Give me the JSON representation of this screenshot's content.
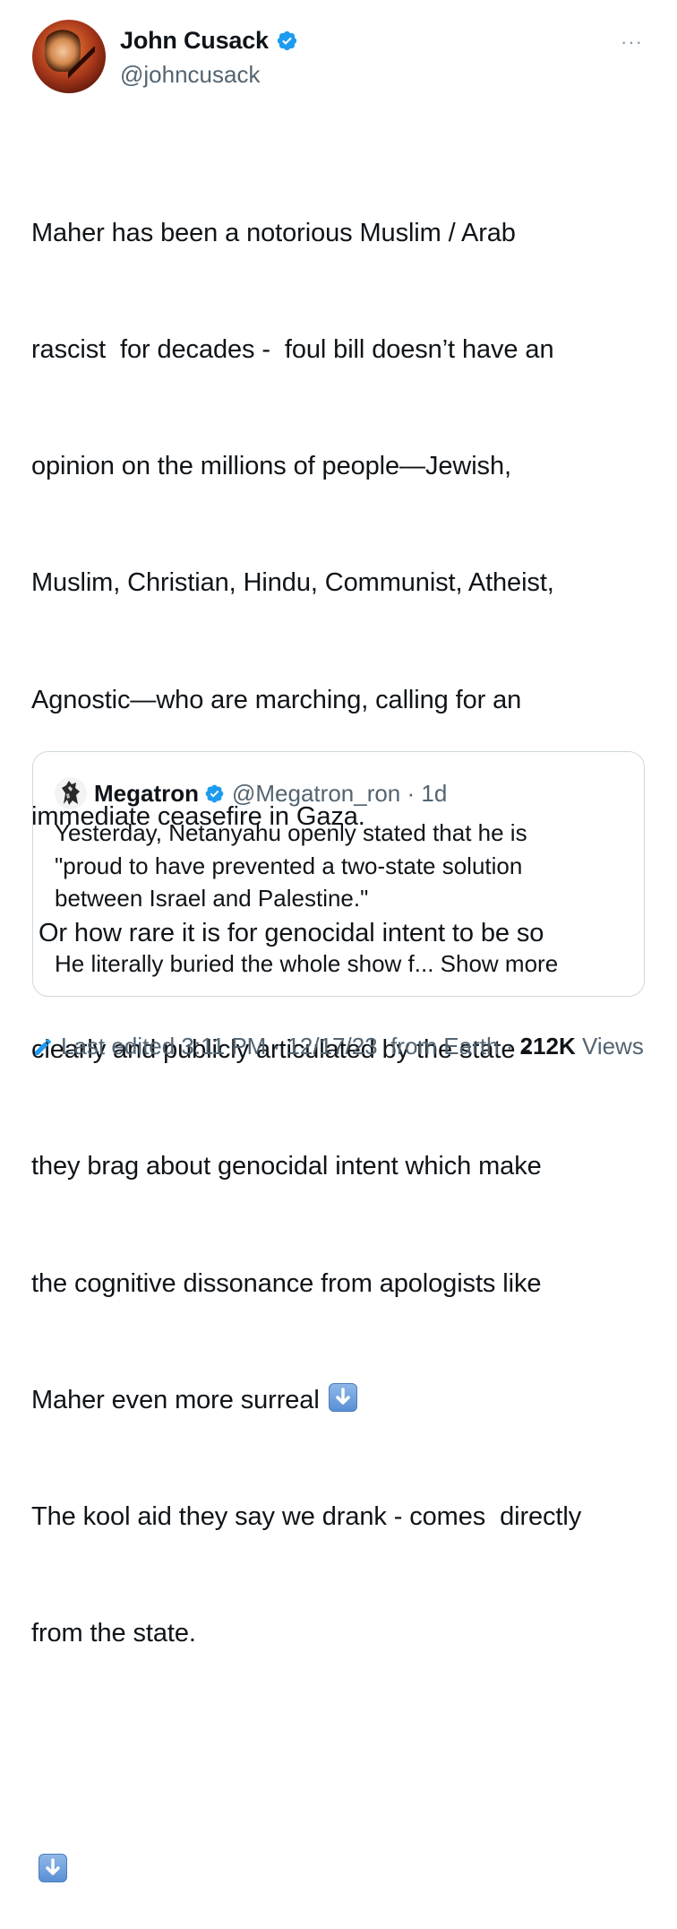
{
  "author": {
    "name": "John Cusack",
    "handle": "@johncusack"
  },
  "tweet": {
    "lines": [
      "Maher has been a notorious Muslim / Arab",
      "rascist  for decades -  foul bill doesn’t have an",
      "opinion on the millions of people—Jewish,",
      "Muslim, Christian, Hindu, Communist, Atheist,",
      "Agnostic—who are marching, calling for an",
      "immediate ceasefire in Gaza.",
      " Or how rare it is for genocidal intent to be so",
      "clearly and publicly articulated by the state -",
      "they brag about genocidal intent which make",
      "the cognitive dissonance from apologists like",
      "Maher even more surreal",
      "The kool aid they say we drank - comes  directly",
      "from the state."
    ]
  },
  "quote": {
    "name": "Megatron",
    "handle": "@Megatron_ron",
    "age": "· 1d",
    "lines": [
      "Yesterday, Netanyahu openly stated that he is",
      "\"proud to have prevented a two-state solution",
      "between Israel and Palestine.\"",
      "",
      "He literally buried the whole show f..."
    ],
    "show_more": "Show more"
  },
  "footer": {
    "edited": "Last edited 3:11 PM · 12/17/23  from Earth · ",
    "views_count": "212K",
    "views_label": " Views"
  },
  "icons": {
    "verified": "verified-badge-icon",
    "arrow": "down-arrow-emoji-icon",
    "more": "more-options-icon",
    "edit": "pencil-icon"
  },
  "colors": {
    "verified_blue": "#1d9bf0",
    "secondary_text": "#536471",
    "border": "#cfd9de"
  }
}
